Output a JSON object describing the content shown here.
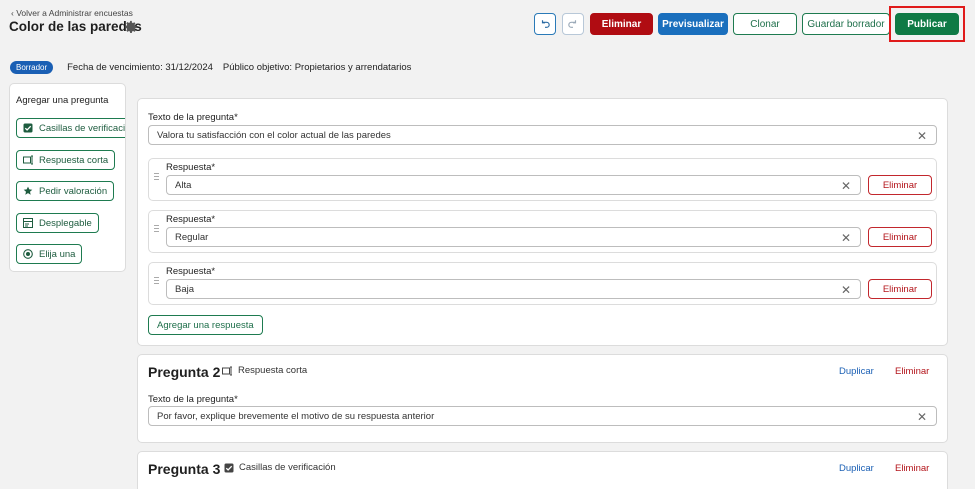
{
  "header": {
    "back_link": "‹ Volver a Administrar encuestas",
    "title": "Color de las paredes",
    "buttons": {
      "delete": "Eliminar",
      "preview": "Previsualizar",
      "clone": "Clonar",
      "save_draft": "Guardar borrador",
      "publish": "Publicar"
    },
    "icons": {
      "undo": "undo-icon",
      "redo": "redo-icon",
      "settings": "gear-icon"
    }
  },
  "meta": {
    "status_badge": "Borrador",
    "due_date": "Fecha de vencimiento: 31/12/2024",
    "audience": "Público objetivo: Propietarios y arrendatarios"
  },
  "sidebar": {
    "title": "Agregar una pregunta",
    "items": [
      {
        "label": "Casillas de verificación",
        "icon": "checkbox-icon"
      },
      {
        "label": "Respuesta corta",
        "icon": "short-answer-icon"
      },
      {
        "label": "Pedir valoración",
        "icon": "star-icon"
      },
      {
        "label": "Desplegable",
        "icon": "dropdown-icon"
      },
      {
        "label": "Elija una",
        "icon": "radio-icon"
      }
    ]
  },
  "question1": {
    "text_label": "Texto de la pregunta*",
    "text_value": "Valora tu satisfacción con el color actual de las paredes",
    "answers": [
      {
        "label": "Respuesta*",
        "value": "Alta",
        "delete": "Eliminar"
      },
      {
        "label": "Respuesta*",
        "value": "Regular",
        "delete": "Eliminar"
      },
      {
        "label": "Respuesta*",
        "value": "Baja",
        "delete": "Eliminar"
      }
    ],
    "add_answer": "Agregar una respuesta"
  },
  "question2": {
    "heading": "Pregunta 2",
    "type_label": "Respuesta corta",
    "duplicate": "Duplicar",
    "delete": "Eliminar",
    "text_label": "Texto de la pregunta*",
    "text_value": "Por favor, explique brevemente el motivo de su respuesta anterior"
  },
  "question3": {
    "heading": "Pregunta 3",
    "type_label": "Casillas de verificación",
    "duplicate": "Duplicar",
    "delete": "Eliminar"
  },
  "colors": {
    "delete_red": "#b00c12",
    "preview_blue": "#1a6fbd",
    "publish_green": "#0f7a45",
    "outline_green": "#1e7b50",
    "highlight_red": "#e01b1b"
  }
}
